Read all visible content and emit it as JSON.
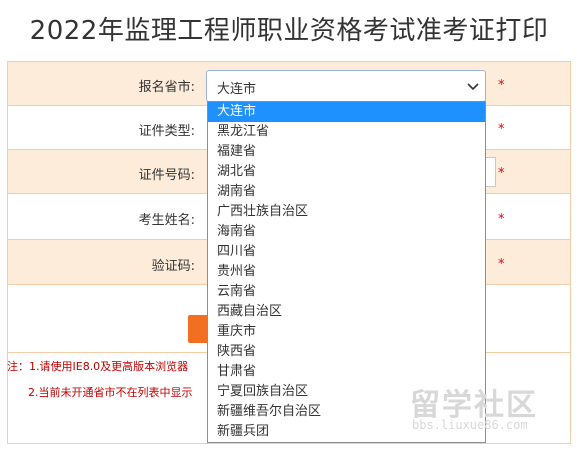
{
  "page": {
    "title": "2022年监理工程师职业资格考试准考证打印"
  },
  "form": {
    "province_label": "报名省市:",
    "idtype_label": "证件类型:",
    "idnum_label": "证件号码:",
    "name_label": "考生姓名:",
    "captcha_label": "验证码:",
    "required_mark": "*",
    "province_value": "大连市"
  },
  "dropdown": {
    "options": [
      "大连市",
      "黑龙江省",
      "福建省",
      "湖北省",
      "湖南省",
      "广西壮族自治区",
      "海南省",
      "四川省",
      "贵州省",
      "云南省",
      "西藏自治区",
      "重庆市",
      "陕西省",
      "甘肃省",
      "宁夏回族自治区",
      "新疆维吾尔自治区",
      "新疆兵团"
    ],
    "selected": 0
  },
  "notes": {
    "line1": "注：1.请使用IE8.0及更高版本浏览器",
    "line2": "2.当前未开通省市不在列表中显示"
  },
  "watermark": {
    "big": "留学社区",
    "small": "bbs.liuxue86.com"
  },
  "colors": {
    "accent": "#f26f21",
    "row_shade": "#fcecd9",
    "selected_bg": "#1e90ff",
    "required": "#e60012"
  }
}
